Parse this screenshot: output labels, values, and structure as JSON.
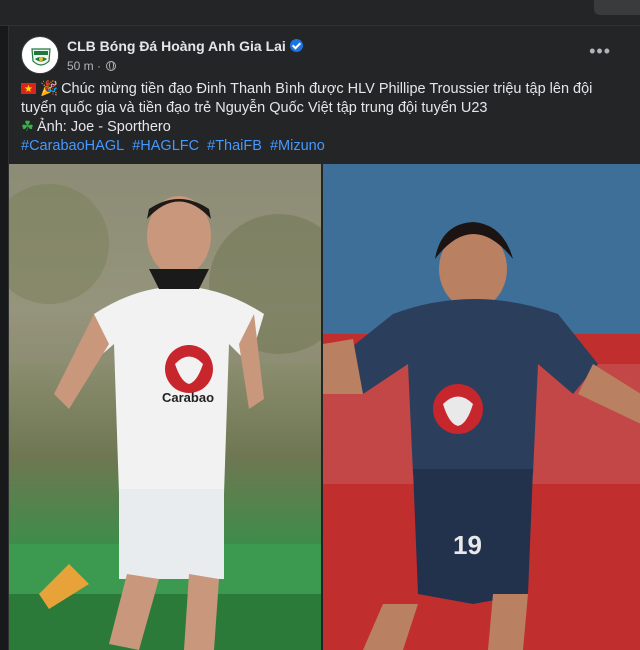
{
  "post": {
    "page_name": "CLB Bóng Đá Hoàng Anh Gia Lai",
    "time": "50 m",
    "time_separator": "·",
    "more_label": "•••",
    "line1": "Chúc mừng tiền đạo Đinh Thanh Bình được HLV Phillipe Troussier triệu tập lên đội tuyển quốc gia và tiền đạo trẻ Nguyễn Quốc Việt tập trung đội tuyển U23",
    "emoji_party": "🎉",
    "photo_credit": "Ảnh: Joe - Sporthero",
    "hashtags": [
      "#CarabaoHAGL",
      "#HAGLFC",
      "#ThaiFB",
      "#Mizuno"
    ]
  },
  "photos": {
    "left_sponsor": "Carabao",
    "right_sponsor": "Carabao",
    "right_number": "19"
  },
  "colors": {
    "background": "#18191a",
    "card": "#242526",
    "link": "#4599ff",
    "verified": "#1b74e4"
  }
}
